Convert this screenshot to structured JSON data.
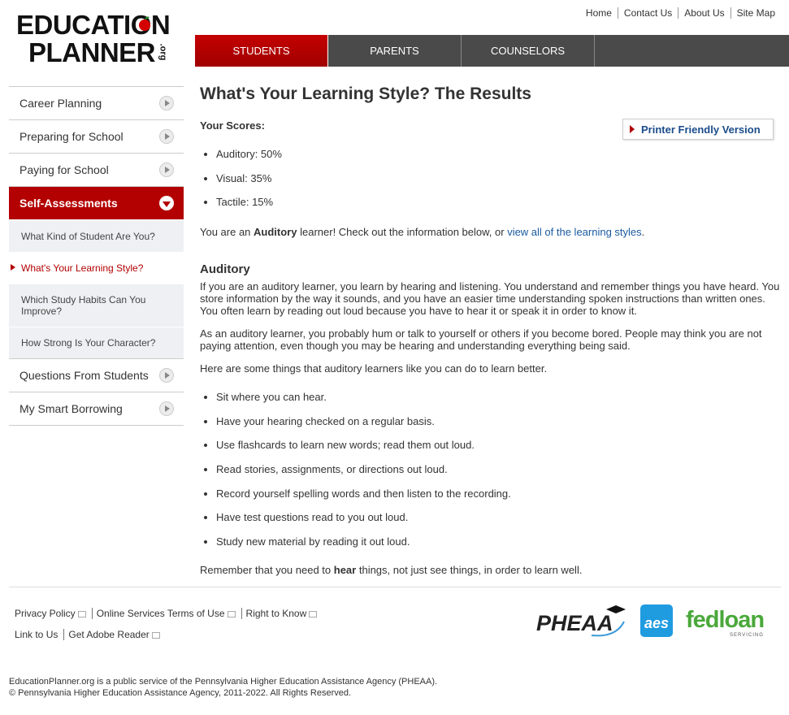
{
  "brand": {
    "line1": "EDUCATION",
    "line2": "PLANNER",
    "org": ".org"
  },
  "util_links": [
    "Home",
    "Contact Us",
    "About Us",
    "Site Map"
  ],
  "tabs": [
    {
      "label": "STUDENTS",
      "active": true
    },
    {
      "label": "PARENTS",
      "active": false
    },
    {
      "label": "COUNSELORS",
      "active": false
    }
  ],
  "sidebar": {
    "items": [
      {
        "label": "Career Planning"
      },
      {
        "label": "Preparing for School"
      },
      {
        "label": "Paying for School"
      },
      {
        "label": "Self-Assessments",
        "active": true
      }
    ],
    "sub": [
      {
        "label": "What Kind of Student Are You?"
      },
      {
        "label": "What's Your Learning Style?",
        "current": true
      },
      {
        "label": "Which Study Habits Can You Improve?"
      },
      {
        "label": "How Strong Is Your Character?"
      }
    ],
    "items_after": [
      {
        "label": "Questions From Students"
      },
      {
        "label": "My Smart Borrowing"
      }
    ]
  },
  "main": {
    "title": "What's Your Learning Style? The Results",
    "scores_label": "Your Scores:",
    "printer": "Printer Friendly Version",
    "scores": [
      "Auditory: 50%",
      "Visual: 35%",
      "Tactile: 15%"
    ],
    "learner_pre": "You are an ",
    "learner_type": "Auditory",
    "learner_mid": " learner! Check out the information below, or ",
    "learner_link": "view all of the learning styles",
    "learner_end": ".",
    "section_title": "Auditory",
    "para1": "If you are an auditory learner, you learn by hearing and listening. You understand and remember things you have heard. You store information by the way it sounds, and you have an easier time understanding spoken instructions than written ones. You often learn by reading out loud because you have to hear it or speak it in order to know it.",
    "para2": "As an auditory learner, you probably hum or talk to yourself or others if you become bored. People may think you are not paying attention, even though you may be hearing and understanding everything being said.",
    "para3": "Here are some things that auditory learners like you can do to learn better.",
    "tips": [
      "Sit where you can hear.",
      "Have your hearing checked on a regular basis.",
      "Use flashcards to learn new words; read them out loud.",
      "Read stories, assignments, or directions out loud.",
      "Record yourself spelling words and then listen to the recording.",
      "Have test questions read to you out loud.",
      "Study new material by reading it out loud."
    ],
    "remember_pre": "Remember that you need to ",
    "remember_bold": "hear",
    "remember_post": " things, not just see things, in order to learn well."
  },
  "footer": {
    "links_row1": [
      "Privacy Policy",
      "Online Services Terms of Use",
      "Right to Know"
    ],
    "links_row2": [
      "Link to Us",
      "Get Adobe Reader"
    ],
    "logo_pheaa": "PHEAA",
    "logo_aes": "aes",
    "logo_fedloan": "fedloan",
    "logo_fedloan_sub": "SERVICING",
    "copy1": "EducationPlanner.org is a public service of the Pennsylvania Higher Education Assistance Agency (PHEAA).",
    "copy2": "© Pennsylvania Higher Education Assistance Agency, 2011-2022. All Rights Reserved."
  },
  "colors": {
    "accent": "#b30000",
    "nav_bg": "#4a4a4a",
    "link": "#1a5aa0"
  }
}
